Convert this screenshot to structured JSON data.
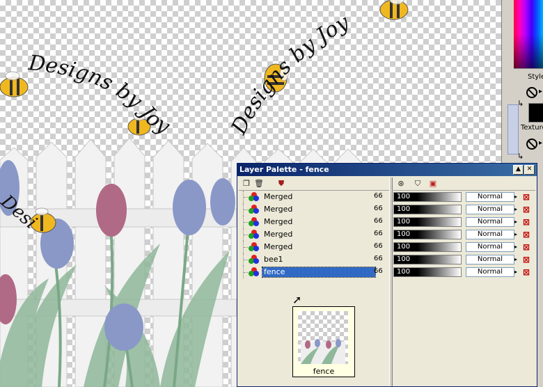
{
  "canvas": {
    "watermark_text": "Designs by Joy"
  },
  "side_panel": {
    "styles_label": "Styles",
    "texture_label": "Texture"
  },
  "palette": {
    "title": "Layer Palette - fence",
    "layers": [
      {
        "name": "Merged",
        "opacity": "100",
        "blend": "Normal",
        "selected": false
      },
      {
        "name": "Merged",
        "opacity": "100",
        "blend": "Normal",
        "selected": false
      },
      {
        "name": "Merged",
        "opacity": "100",
        "blend": "Normal",
        "selected": false
      },
      {
        "name": "Merged",
        "opacity": "100",
        "blend": "Normal",
        "selected": false
      },
      {
        "name": "Merged",
        "opacity": "100",
        "blend": "Normal",
        "selected": false
      },
      {
        "name": "bee1",
        "opacity": "100",
        "blend": "Normal",
        "selected": false
      },
      {
        "name": "fence",
        "opacity": "100",
        "blend": "Normal",
        "selected": true
      }
    ],
    "thumbnail_label": "fence",
    "colors": {
      "title_bar": "#0a246a",
      "selection": "#316ac5",
      "panel_bg": "#ece9d8"
    }
  }
}
